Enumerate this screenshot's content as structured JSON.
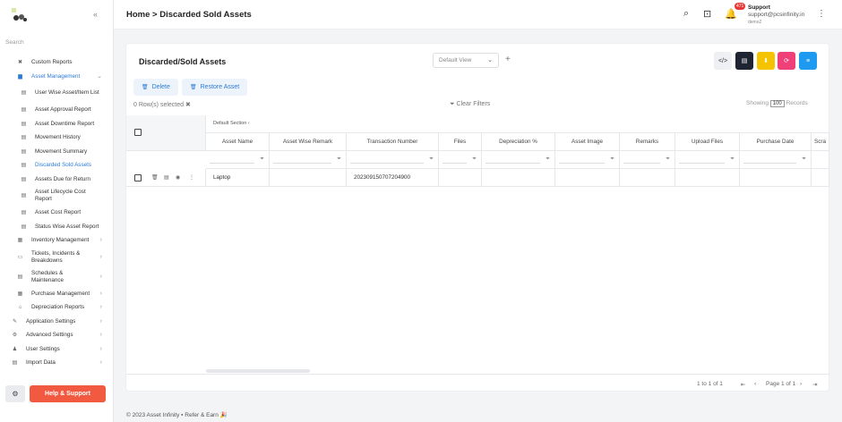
{
  "sidebar": {
    "search_placeholder": "Search",
    "collapse_icon": "«",
    "items": [
      {
        "label": "Custom Reports",
        "icon": "✖"
      },
      {
        "label": "Asset Management",
        "icon": "▆"
      },
      {
        "label": "User Wise Asset/Item List",
        "icon": "▤"
      },
      {
        "label": "Asset Approval Report",
        "icon": "▤"
      },
      {
        "label": "Asset Downtime Report",
        "icon": "▤"
      },
      {
        "label": "Movement History",
        "icon": "▤"
      },
      {
        "label": "Movement Summary",
        "icon": "▤"
      },
      {
        "label": "Discarded Sold Assets",
        "icon": "▤"
      },
      {
        "label": "Assets Due for Return",
        "icon": "▤"
      },
      {
        "label": "Asset Lifecycle Cost Report",
        "icon": "▤"
      },
      {
        "label": "Asset Cost Report",
        "icon": "▤"
      },
      {
        "label": "Status Wise Asset Report",
        "icon": "▤"
      },
      {
        "label": "Inventory Management",
        "icon": "▦"
      },
      {
        "label": "Tickets, Incidents & Breakdowns",
        "icon": "▭"
      },
      {
        "label": "Schedules & Maintenance",
        "icon": "▤"
      },
      {
        "label": "Purchase Management",
        "icon": "▦"
      },
      {
        "label": "Depreciation Reports",
        "icon": "⌂"
      },
      {
        "label": "Application Settings",
        "icon": "✎"
      },
      {
        "label": "Advanced Settings",
        "icon": "⚙"
      },
      {
        "label": "User Settings",
        "icon": "♟"
      },
      {
        "label": "Import Data",
        "icon": "▤"
      }
    ],
    "help_label": "Help & Support",
    "gear_icon": "⚙"
  },
  "header": {
    "breadcrumb": "Home > Discarded Sold Assets",
    "notif_count": "471",
    "user_name": "Support",
    "user_email": "support@pcsinfinity.in",
    "user_org": "demo2",
    "search_icon": "⌕",
    "scan_icon": "⊡",
    "bell_icon": "🔔",
    "kebab_icon": "⋮"
  },
  "card": {
    "title": "Discarded/Sold Assets",
    "view_value": "Default View",
    "plus_icon": "+",
    "actions": [
      {
        "name": "code-icon",
        "glyph": "</>",
        "color": "#eef0f3",
        "fg": "#333"
      },
      {
        "name": "pdf-icon",
        "glyph": "▤",
        "color": "#1f2433",
        "fg": "#fff"
      },
      {
        "name": "download-icon",
        "glyph": "⬇",
        "color": "#f5c400",
        "fg": "#fff"
      },
      {
        "name": "refresh-icon",
        "glyph": "⟳",
        "color": "#f0407a",
        "fg": "#fff"
      },
      {
        "name": "list-icon",
        "glyph": "≡",
        "color": "#1e9bf0",
        "fg": "#fff"
      }
    ],
    "delete_label": "Delete",
    "restore_label": "Restore Asset",
    "rows_selected": "0  Row(s) selected ✖",
    "clear_filters": "Clear Filters",
    "showing_label": "Showing",
    "records_label": "Records",
    "page_size": "100",
    "section_label": "Default Section"
  },
  "table": {
    "columns": [
      "Asset Name",
      "Asset Wise Remark",
      "Transaction Number",
      "Files",
      "Depreciation %",
      "Asset Image",
      "Remarks",
      "Upload Files",
      "Purchase Date",
      "Scra"
    ],
    "rows": [
      [
        "Laptop",
        "",
        "202309150707204900",
        "",
        "",
        "",
        "",
        "",
        "",
        ""
      ]
    ]
  },
  "pagination": {
    "range": "1 to 1 of 1",
    "page_text": "Page 1 of 1"
  },
  "footer": {
    "copyright": "© 2023  Asset Infinity ▪ Refer & Earn 🎉"
  }
}
